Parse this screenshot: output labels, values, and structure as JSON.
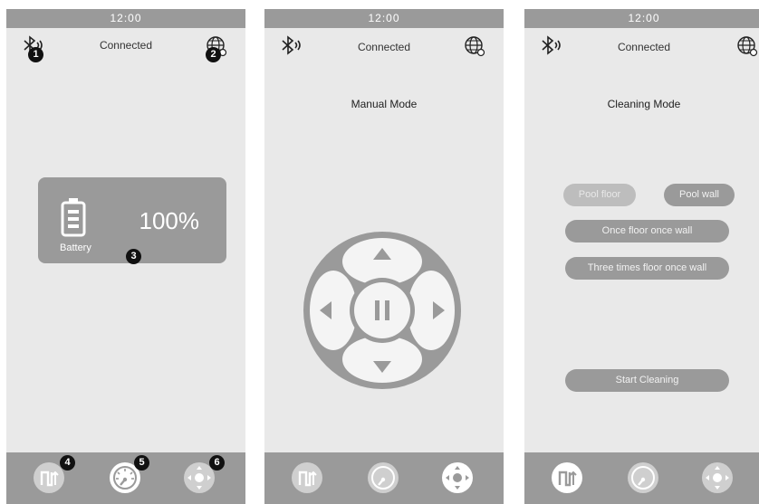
{
  "status_bar": {
    "time": "12:00"
  },
  "connection": {
    "status": "Connected"
  },
  "screens": [
    {
      "name": "home"
    },
    {
      "name": "manual",
      "title": "Manual Mode"
    },
    {
      "name": "cleaning",
      "title": "Cleaning Mode"
    }
  ],
  "battery": {
    "level_label": "100%",
    "label": "Battery",
    "level_fraction": 1.0
  },
  "cleaning": {
    "options": [
      "Pool floor",
      "Pool wall",
      "Once floor once wall",
      "Three times floor once wall"
    ],
    "start_label": "Start Cleaning"
  },
  "markers": [
    "1",
    "2",
    "3",
    "4",
    "5",
    "6"
  ],
  "icons": [
    "bluetooth-icon",
    "globe-icon",
    "battery-icon",
    "cleaning-mode-icon",
    "gauge-icon",
    "joystick-icon",
    "pause-icon"
  ],
  "colors": {
    "gray": "#9a9a9a",
    "background": "#e9e9e9",
    "light": "#f2f2f2",
    "marker": "#111111"
  }
}
